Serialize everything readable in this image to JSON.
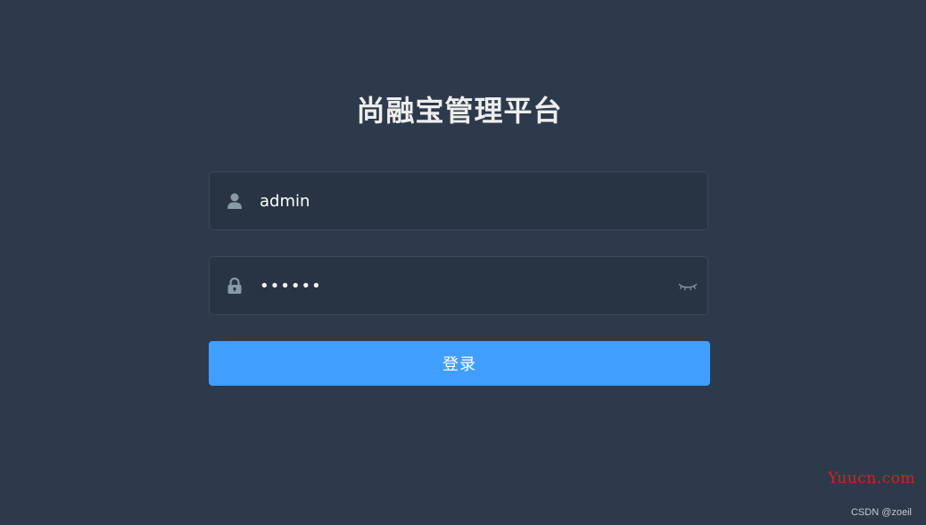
{
  "login": {
    "title": "尚融宝管理平台",
    "username": {
      "value": "admin",
      "icon": "user-icon"
    },
    "password": {
      "value": "111111",
      "icon": "lock-icon",
      "toggle_icon": "eye-closed-icon"
    },
    "submit_label": "登录"
  },
  "watermark": "Yuucn.com",
  "credit": "CSDN @zoeil",
  "colors": {
    "background": "#2d3a4b",
    "input_bg": "#283443",
    "accent": "#409eff",
    "icon": "#889aa4",
    "watermark": "#e61919"
  }
}
